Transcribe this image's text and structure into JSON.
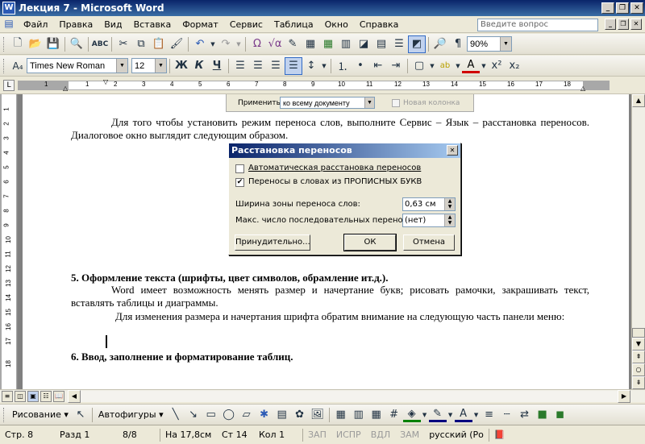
{
  "window": {
    "title": "Лекция 7 - Microsoft Word",
    "app_icon": "W"
  },
  "menu": {
    "items": [
      "Файл",
      "Правка",
      "Вид",
      "Вставка",
      "Формат",
      "Сервис",
      "Таблица",
      "Окно",
      "Справка"
    ],
    "ask_placeholder": "Введите вопрос"
  },
  "toolbar_standard": {
    "zoom": "90%"
  },
  "toolbar_format": {
    "font": "Times New Roman",
    "size": "12",
    "bold": "Ж",
    "italic": "К",
    "underline": "Ч"
  },
  "ruler": {
    "numbers": [
      "1",
      "1",
      "2",
      "3",
      "4",
      "5",
      "6",
      "7",
      "8",
      "9",
      "10",
      "11",
      "12",
      "13",
      "14",
      "15",
      "16",
      "17",
      "18"
    ],
    "vnumbers": [
      "1",
      "2",
      "3",
      "4",
      "5",
      "6",
      "7",
      "8",
      "9",
      "10",
      "11",
      "12",
      "13",
      "14",
      "15",
      "16",
      "17",
      "18"
    ]
  },
  "bg_dialog": {
    "apply_label": "Применить:",
    "apply_value": "ко всему документу",
    "new_column": "Новая колонка"
  },
  "document": {
    "p1": "Для того чтобы установить режим переноса слов, выполните Сервис – Язык – расстановка переносов. Диалоговое окно выглядит следующим образом.",
    "h5": "5.  Оформление текста (шрифты, цвет символов, обрамление  ит.д.).",
    "p2": "Word имеет возможность менять размер и начертание букв; рисовать рамочки, закрашивать текст, вставлять таблицы и диаграммы.",
    "p3": "Для изменения размера и начертания шрифта обратим внимание на следующую часть панели меню:",
    "h6": "6.  Ввод, заполнение и форматирование таблиц."
  },
  "dialog": {
    "title": "Расстановка переносов",
    "auto_label": "Автоматическая расстановка переносов",
    "auto_checked": false,
    "caps_label": "Переносы в словах из ПРОПИСНЫХ БУКВ",
    "caps_checked": true,
    "zone_label": "Ширина зоны переноса слов:",
    "zone_value": "0,63 см",
    "max_label": "Макс. число последовательных переносов:",
    "max_value": "(нет)",
    "btn_manual": "Принудительно...",
    "btn_ok": "ОК",
    "btn_cancel": "Отмена"
  },
  "drawing": {
    "draw_label": "Рисование ▾",
    "autoshapes_label": "Автофигуры ▾"
  },
  "status": {
    "page": "Стр. 8",
    "section": "Разд 1",
    "pages": "8/8",
    "at": "На 17,8см",
    "line": "Ст 14",
    "col": "Кол 1",
    "rec": "ЗАП",
    "trk": "ИСПР",
    "ext": "ВДЛ",
    "ovr": "ЗАМ",
    "lang": "русский (Ро"
  }
}
